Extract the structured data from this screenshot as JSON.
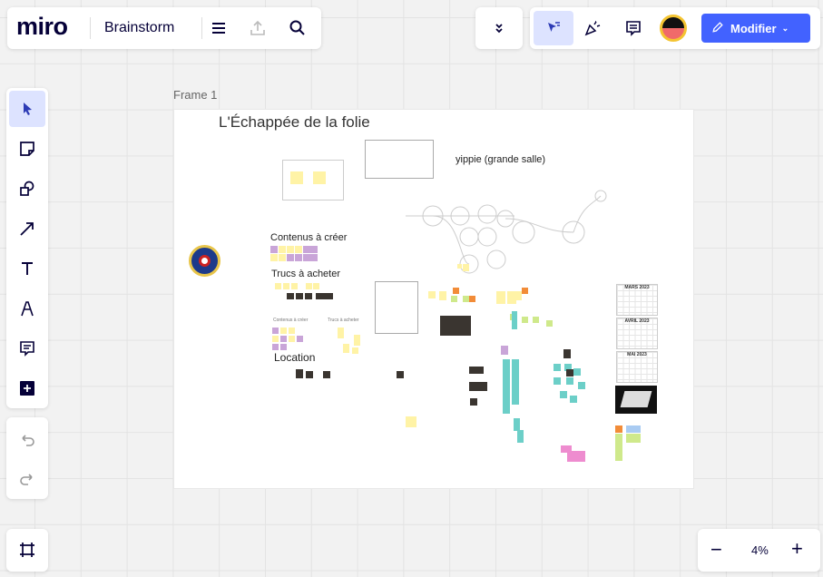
{
  "topbar": {
    "logo": "miro",
    "board_name": "Brainstorm",
    "icons": [
      "menu-icon",
      "upload-icon",
      "search-icon"
    ]
  },
  "right_toolbar": {
    "collapse_icon": "chevrons-down-icon",
    "tools": [
      "cursor-select-icon",
      "celebrate-icon",
      "comment-icon",
      "avatar"
    ],
    "modifier_label": "Modifier",
    "accent": "#4262ff"
  },
  "left_toolbar": {
    "tools": [
      "select",
      "sticky-note",
      "shapes",
      "arrow",
      "text",
      "pen",
      "comment",
      "add"
    ],
    "history": [
      "undo",
      "redo"
    ]
  },
  "frame": {
    "label": "Frame 1",
    "title": "L'Échappée de la folie",
    "texts": {
      "yippie": "yippie (grande salle)",
      "contenus": "Contenus à créer",
      "trucs": "Trucs à acheter",
      "location": "Location",
      "contenus_small": "Contenus à créer",
      "trucs_small": "Trucs à acheter"
    },
    "calendars": [
      "MARS 2023",
      "AVRIL 2023",
      "MAI 2023"
    ]
  },
  "zoom": {
    "level": "4%",
    "minus": "−",
    "plus": "+"
  },
  "colors": {
    "yellow": "#fff3a6",
    "purple": "#c9a5d8",
    "teal": "#6ccfc8",
    "green": "#cfe98b",
    "orange": "#f28c38",
    "pink": "#ee8ccf",
    "blue": "#a9cbf2"
  }
}
